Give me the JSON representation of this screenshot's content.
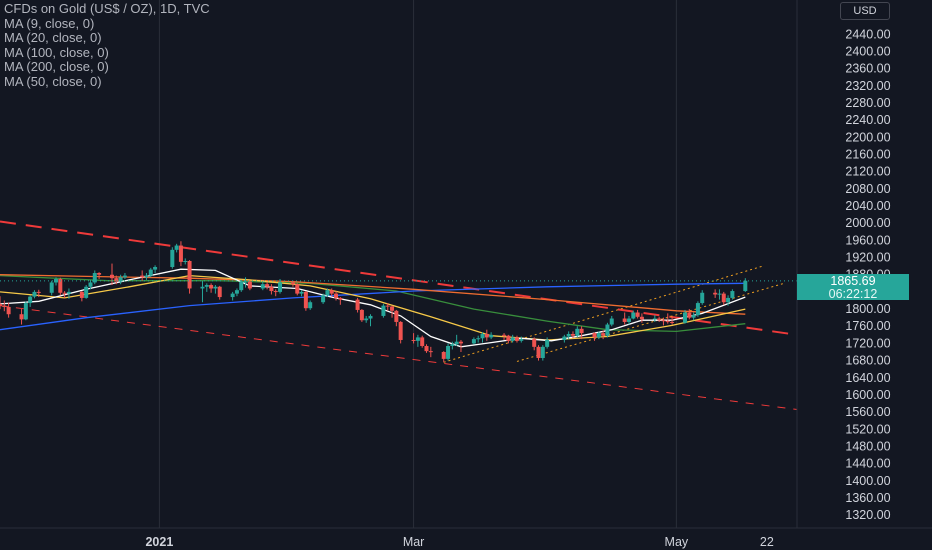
{
  "legend": {
    "title": "CFDs on Gold (US$ / OZ), 1D, TVC",
    "lines": [
      "MA (9, close, 0)",
      "MA (20, close, 0)",
      "MA (100, close, 0)",
      "MA (200, close, 0)",
      "MA (50, close, 0)"
    ]
  },
  "currency": "USD",
  "last_price": {
    "value": "1865.69",
    "countdown": "06:22:12"
  },
  "colors": {
    "up": "#26a69a",
    "down": "#ef5350",
    "background": "#131722",
    "grid": "#1e222d",
    "axis_text": "#d1d4dc"
  },
  "chart_data": {
    "type": "candlestick",
    "symbol": "CFDs on Gold (US$ / OZ)",
    "interval": "1D",
    "source": "TVC",
    "y_axis": {
      "position": "right",
      "range": [
        1290,
        2520
      ],
      "ticks": [
        1320,
        1360,
        1400,
        1440,
        1480,
        1520,
        1560,
        1600,
        1640,
        1680,
        1720,
        1760,
        1800,
        1840,
        1880,
        1920,
        1960,
        2000,
        2040,
        2080,
        2120,
        2160,
        2200,
        2240,
        2280,
        2320,
        2360,
        2400,
        2440
      ]
    },
    "x_axis": {
      "range": [
        "2020-11-25",
        "2021-05-29"
      ],
      "labels": [
        {
          "date": "2021-01-01",
          "text": "2021"
        },
        {
          "date": "2021-03-01",
          "text": "Mar"
        },
        {
          "date": "2021-05-01",
          "text": "May"
        },
        {
          "date": "2021-05-22",
          "text": "22"
        }
      ]
    },
    "candles": [
      [
        "2020-11-25",
        1812,
        1830,
        1800,
        1808
      ],
      [
        "2020-11-26",
        1808,
        1820,
        1795,
        1805
      ],
      [
        "2020-11-27",
        1805,
        1815,
        1780,
        1788
      ],
      [
        "2020-11-30",
        1788,
        1800,
        1764,
        1776
      ],
      [
        "2020-12-01",
        1776,
        1818,
        1774,
        1814
      ],
      [
        "2020-12-02",
        1814,
        1832,
        1805,
        1829
      ],
      [
        "2020-12-03",
        1829,
        1844,
        1825,
        1840
      ],
      [
        "2020-12-04",
        1840,
        1845,
        1828,
        1838
      ],
      [
        "2020-12-07",
        1838,
        1866,
        1832,
        1862
      ],
      [
        "2020-12-08",
        1862,
        1874,
        1855,
        1870
      ],
      [
        "2020-12-09",
        1870,
        1873,
        1832,
        1838
      ],
      [
        "2020-12-10",
        1838,
        1842,
        1826,
        1836
      ],
      [
        "2020-12-11",
        1836,
        1848,
        1824,
        1840
      ],
      [
        "2020-12-14",
        1840,
        1842,
        1818,
        1826
      ],
      [
        "2020-12-15",
        1826,
        1856,
        1824,
        1852
      ],
      [
        "2020-12-16",
        1852,
        1868,
        1846,
        1862
      ],
      [
        "2020-12-17",
        1862,
        1890,
        1858,
        1884
      ],
      [
        "2020-12-18",
        1884,
        1886,
        1870,
        1880
      ],
      [
        "2020-12-21",
        1880,
        1906,
        1856,
        1872
      ],
      [
        "2020-12-22",
        1872,
        1878,
        1858,
        1864
      ],
      [
        "2020-12-23",
        1864,
        1880,
        1858,
        1874
      ],
      [
        "2020-12-24",
        1874,
        1884,
        1870,
        1878
      ],
      [
        "2020-12-28",
        1878,
        1890,
        1866,
        1874
      ],
      [
        "2020-12-29",
        1874,
        1884,
        1868,
        1878
      ],
      [
        "2020-12-30",
        1878,
        1896,
        1874,
        1892
      ],
      [
        "2020-12-31",
        1892,
        1902,
        1884,
        1898
      ],
      [
        "2021-01-04",
        1898,
        1944,
        1894,
        1938
      ],
      [
        "2021-01-05",
        1938,
        1952,
        1932,
        1948
      ],
      [
        "2021-01-06",
        1948,
        1958,
        1900,
        1910
      ],
      [
        "2021-01-07",
        1910,
        1918,
        1904,
        1912
      ],
      [
        "2021-01-08",
        1912,
        1914,
        1836,
        1848
      ],
      [
        "2021-01-11",
        1848,
        1866,
        1816,
        1852
      ],
      [
        "2021-01-12",
        1852,
        1860,
        1840,
        1856
      ],
      [
        "2021-01-13",
        1856,
        1860,
        1838,
        1848
      ],
      [
        "2021-01-14",
        1848,
        1856,
        1836,
        1852
      ],
      [
        "2021-01-15",
        1852,
        1854,
        1822,
        1828
      ],
      [
        "2021-01-18",
        1828,
        1840,
        1820,
        1836
      ],
      [
        "2021-01-19",
        1836,
        1848,
        1830,
        1844
      ],
      [
        "2021-01-20",
        1844,
        1868,
        1840,
        1864
      ],
      [
        "2021-01-21",
        1864,
        1874,
        1850,
        1864
      ],
      [
        "2021-01-22",
        1864,
        1866,
        1844,
        1848
      ],
      [
        "2021-01-25",
        1848,
        1866,
        1844,
        1858
      ],
      [
        "2021-01-26",
        1858,
        1864,
        1846,
        1852
      ],
      [
        "2021-01-27",
        1852,
        1858,
        1834,
        1842
      ],
      [
        "2021-01-28",
        1842,
        1846,
        1830,
        1840
      ],
      [
        "2021-01-29",
        1840,
        1870,
        1836,
        1862
      ],
      [
        "2021-02-01",
        1862,
        1866,
        1852,
        1858
      ],
      [
        "2021-02-02",
        1858,
        1860,
        1832,
        1836
      ],
      [
        "2021-02-03",
        1836,
        1844,
        1830,
        1840
      ],
      [
        "2021-02-04",
        1840,
        1842,
        1796,
        1802
      ],
      [
        "2021-02-05",
        1802,
        1820,
        1798,
        1816
      ],
      [
        "2021-02-08",
        1816,
        1836,
        1812,
        1832
      ],
      [
        "2021-02-09",
        1832,
        1848,
        1828,
        1844
      ],
      [
        "2021-02-10",
        1844,
        1848,
        1830,
        1836
      ],
      [
        "2021-02-11",
        1836,
        1842,
        1820,
        1826
      ],
      [
        "2021-02-12",
        1826,
        1828,
        1810,
        1822
      ],
      [
        "2021-02-16",
        1822,
        1826,
        1792,
        1798
      ],
      [
        "2021-02-17",
        1798,
        1800,
        1770,
        1774
      ],
      [
        "2021-02-18",
        1774,
        1784,
        1768,
        1778
      ],
      [
        "2021-02-19",
        1778,
        1788,
        1760,
        1784
      ],
      [
        "2021-02-22",
        1784,
        1812,
        1780,
        1808
      ],
      [
        "2021-02-23",
        1808,
        1814,
        1796,
        1806
      ],
      [
        "2021-02-24",
        1806,
        1808,
        1780,
        1796
      ],
      [
        "2021-02-25",
        1796,
        1798,
        1760,
        1770
      ],
      [
        "2021-02-26",
        1770,
        1772,
        1720,
        1728
      ],
      [
        "2021-03-01",
        1728,
        1744,
        1720,
        1726
      ],
      [
        "2021-03-02",
        1726,
        1740,
        1712,
        1734
      ],
      [
        "2021-03-03",
        1734,
        1738,
        1710,
        1714
      ],
      [
        "2021-03-04",
        1714,
        1718,
        1698,
        1702
      ],
      [
        "2021-03-05",
        1702,
        1712,
        1688,
        1700
      ],
      [
        "2021-03-08",
        1700,
        1702,
        1676,
        1684
      ],
      [
        "2021-03-09",
        1684,
        1720,
        1680,
        1714
      ],
      [
        "2021-03-10",
        1714,
        1724,
        1706,
        1718
      ],
      [
        "2021-03-11",
        1718,
        1740,
        1714,
        1724
      ],
      [
        "2021-03-12",
        1724,
        1728,
        1700,
        1720
      ],
      [
        "2021-03-15",
        1720,
        1734,
        1718,
        1730
      ],
      [
        "2021-03-16",
        1730,
        1738,
        1722,
        1732
      ],
      [
        "2021-03-17",
        1732,
        1746,
        1722,
        1742
      ],
      [
        "2021-03-18",
        1742,
        1752,
        1726,
        1734
      ],
      [
        "2021-03-19",
        1734,
        1746,
        1730,
        1740
      ],
      [
        "2021-03-22",
        1740,
        1744,
        1728,
        1738
      ],
      [
        "2021-03-23",
        1738,
        1740,
        1720,
        1726
      ],
      [
        "2021-03-24",
        1726,
        1740,
        1722,
        1734
      ],
      [
        "2021-03-25",
        1734,
        1738,
        1722,
        1726
      ],
      [
        "2021-03-26",
        1726,
        1736,
        1722,
        1730
      ],
      [
        "2021-03-29",
        1730,
        1734,
        1704,
        1712
      ],
      [
        "2021-03-30",
        1712,
        1716,
        1680,
        1686
      ],
      [
        "2021-03-31",
        1686,
        1716,
        1680,
        1712
      ],
      [
        "2021-04-01",
        1712,
        1734,
        1708,
        1728
      ],
      [
        "2021-04-05",
        1728,
        1740,
        1722,
        1736
      ],
      [
        "2021-04-06",
        1736,
        1748,
        1730,
        1742
      ],
      [
        "2021-04-07",
        1742,
        1748,
        1732,
        1738
      ],
      [
        "2021-04-08",
        1738,
        1760,
        1734,
        1754
      ],
      [
        "2021-04-09",
        1754,
        1760,
        1730,
        1744
      ],
      [
        "2021-04-12",
        1744,
        1746,
        1726,
        1734
      ],
      [
        "2021-04-13",
        1734,
        1748,
        1730,
        1744
      ],
      [
        "2021-04-14",
        1744,
        1750,
        1730,
        1738
      ],
      [
        "2021-04-15",
        1738,
        1768,
        1734,
        1764
      ],
      [
        "2021-04-16",
        1764,
        1784,
        1760,
        1778
      ],
      [
        "2021-04-19",
        1778,
        1792,
        1764,
        1770
      ],
      [
        "2021-04-20",
        1770,
        1784,
        1764,
        1778
      ],
      [
        "2021-04-21",
        1778,
        1796,
        1776,
        1792
      ],
      [
        "2021-04-22",
        1792,
        1798,
        1778,
        1782
      ],
      [
        "2021-04-23",
        1782,
        1790,
        1768,
        1776
      ],
      [
        "2021-04-26",
        1776,
        1786,
        1770,
        1778
      ],
      [
        "2021-04-27",
        1778,
        1782,
        1770,
        1774
      ],
      [
        "2021-04-28",
        1774,
        1780,
        1762,
        1772
      ],
      [
        "2021-04-29",
        1772,
        1790,
        1766,
        1770
      ],
      [
        "2021-04-30",
        1770,
        1782,
        1764,
        1768
      ],
      [
        "2021-05-03",
        1768,
        1798,
        1766,
        1792
      ],
      [
        "2021-05-04",
        1792,
        1800,
        1776,
        1780
      ],
      [
        "2021-05-05",
        1780,
        1792,
        1774,
        1786
      ],
      [
        "2021-05-06",
        1786,
        1818,
        1782,
        1814
      ],
      [
        "2021-05-07",
        1814,
        1844,
        1810,
        1838
      ],
      [
        "2021-05-10",
        1838,
        1846,
        1826,
        1834
      ],
      [
        "2021-05-11",
        1834,
        1846,
        1822,
        1836
      ],
      [
        "2021-05-12",
        1836,
        1840,
        1810,
        1816
      ],
      [
        "2021-05-13",
        1816,
        1832,
        1808,
        1826
      ],
      [
        "2021-05-14",
        1826,
        1846,
        1822,
        1842
      ],
      [
        "2021-05-17",
        1842,
        1872,
        1840,
        1866
      ]
    ],
    "moving_averages": [
      {
        "name": "MA (9, close, 0)",
        "color": "#ffffff",
        "points": [
          [
            "2020-11-25",
            1812
          ],
          [
            "2020-12-04",
            1818
          ],
          [
            "2020-12-15",
            1846
          ],
          [
            "2020-12-25",
            1868
          ],
          [
            "2021-01-06",
            1893
          ],
          [
            "2021-01-14",
            1890
          ],
          [
            "2021-01-22",
            1854
          ],
          [
            "2021-02-02",
            1848
          ],
          [
            "2021-02-10",
            1828
          ],
          [
            "2021-02-19",
            1810
          ],
          [
            "2021-02-26",
            1784
          ],
          [
            "2021-03-05",
            1736
          ],
          [
            "2021-03-12",
            1712
          ],
          [
            "2021-03-19",
            1722
          ],
          [
            "2021-03-26",
            1732
          ],
          [
            "2021-04-02",
            1726
          ],
          [
            "2021-04-09",
            1738
          ],
          [
            "2021-04-16",
            1752
          ],
          [
            "2021-04-23",
            1774
          ],
          [
            "2021-04-30",
            1774
          ],
          [
            "2021-05-07",
            1790
          ],
          [
            "2021-05-17",
            1828
          ]
        ]
      },
      {
        "name": "MA (20, close, 0)",
        "color": "#f7c948",
        "points": [
          [
            "2020-11-25",
            1840
          ],
          [
            "2020-12-10",
            1826
          ],
          [
            "2020-12-25",
            1852
          ],
          [
            "2021-01-08",
            1878
          ],
          [
            "2021-01-22",
            1868
          ],
          [
            "2021-02-05",
            1854
          ],
          [
            "2021-02-19",
            1824
          ],
          [
            "2021-03-05",
            1782
          ],
          [
            "2021-03-19",
            1738
          ],
          [
            "2021-04-01",
            1728
          ],
          [
            "2021-04-15",
            1736
          ],
          [
            "2021-04-30",
            1762
          ],
          [
            "2021-05-17",
            1800
          ]
        ]
      },
      {
        "name": "MA (100, close, 0)",
        "color": "#ef6c30",
        "points": [
          [
            "2020-11-25",
            1880
          ],
          [
            "2020-12-15",
            1876
          ],
          [
            "2021-01-08",
            1872
          ],
          [
            "2021-02-01",
            1864
          ],
          [
            "2021-03-01",
            1846
          ],
          [
            "2021-04-01",
            1822
          ],
          [
            "2021-05-01",
            1796
          ],
          [
            "2021-05-17",
            1788
          ]
        ]
      },
      {
        "name": "MA (200, close, 0)",
        "color": "#2962ff",
        "points": [
          [
            "2020-11-25",
            1752
          ],
          [
            "2020-12-15",
            1780
          ],
          [
            "2021-01-08",
            1808
          ],
          [
            "2021-02-01",
            1826
          ],
          [
            "2021-03-01",
            1842
          ],
          [
            "2021-04-01",
            1852
          ],
          [
            "2021-05-01",
            1858
          ],
          [
            "2021-05-17",
            1860
          ]
        ]
      },
      {
        "name": "MA (50, close, 0)",
        "color": "#388e3c",
        "points": [
          [
            "2020-11-25",
            1878
          ],
          [
            "2020-12-20",
            1866
          ],
          [
            "2021-01-15",
            1866
          ],
          [
            "2021-02-05",
            1860
          ],
          [
            "2021-02-25",
            1842
          ],
          [
            "2021-03-15",
            1800
          ],
          [
            "2021-04-01",
            1772
          ],
          [
            "2021-04-15",
            1752
          ],
          [
            "2021-05-01",
            1748
          ],
          [
            "2021-05-17",
            1766
          ]
        ]
      }
    ],
    "trendlines": [
      {
        "color": "#ef3a3a",
        "style": "dashed-long",
        "from": [
          "2020-11-25",
          2004
        ],
        "to": [
          "2021-05-29",
          1740
        ]
      },
      {
        "color": "#ef3a3a",
        "style": "dashed",
        "from": [
          "2020-11-25",
          1808
        ],
        "to": [
          "2021-05-29",
          1566
        ]
      },
      {
        "color": "#f0a020",
        "style": "dotted",
        "from": [
          "2021-03-08",
          1676
        ],
        "to": [
          "2021-05-21",
          1900
        ]
      },
      {
        "color": "#f0a020",
        "style": "dotted",
        "from": [
          "2021-03-25",
          1678
        ],
        "to": [
          "2021-05-26",
          1860
        ]
      }
    ],
    "vertical_lines": [
      "2021-01-01",
      "2021-03-01",
      "2021-05-01"
    ],
    "last_price": 1865.69
  }
}
